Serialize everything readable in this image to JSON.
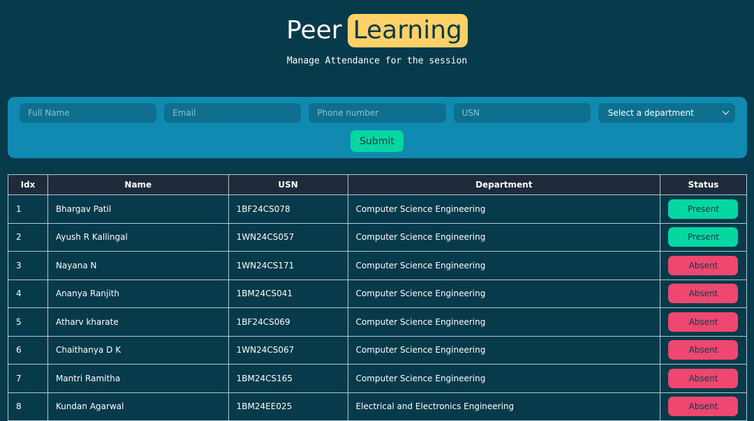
{
  "header": {
    "title_plain": "Peer",
    "title_highlight": "Learning",
    "subtitle": "Manage Attendance for the session"
  },
  "form": {
    "full_name_placeholder": "Full Name",
    "email_placeholder": "Email",
    "phone_placeholder": "Phone number",
    "usn_placeholder": "USN",
    "department_selected": "Select a department",
    "submit_label": "Submit"
  },
  "table": {
    "columns": [
      "Idx",
      "Name",
      "USN",
      "Department",
      "Status"
    ],
    "rows": [
      {
        "idx": "1",
        "name": "Bhargav Patil",
        "usn": "1BF24CS078",
        "department": "Computer Science Engineering",
        "status": "Present"
      },
      {
        "idx": "2",
        "name": "Ayush R Kallingal",
        "usn": "1WN24CS057",
        "department": "Computer Science Engineering",
        "status": "Present"
      },
      {
        "idx": "3",
        "name": "Nayana N",
        "usn": "1WN24CS171",
        "department": "Computer Science Engineering",
        "status": "Absent"
      },
      {
        "idx": "4",
        "name": "Ananya Ranjith",
        "usn": "1BM24CS041",
        "department": "Computer Science Engineering",
        "status": "Absent"
      },
      {
        "idx": "5",
        "name": "Atharv kharate",
        "usn": "1BF24CS069",
        "department": "Computer Science Engineering",
        "status": "Absent"
      },
      {
        "idx": "6",
        "name": "Chaithanya D K",
        "usn": "1WN24CS067",
        "department": "Computer Science Engineering",
        "status": "Absent"
      },
      {
        "idx": "7",
        "name": "Mantri Ramitha",
        "usn": "1BM24CS165",
        "department": "Computer Science Engineering",
        "status": "Absent"
      },
      {
        "idx": "8",
        "name": "Kundan Agarwal",
        "usn": "1BM24EE025",
        "department": "Electrical and Electronics Engineering",
        "status": "Absent"
      }
    ]
  },
  "colors": {
    "background": "#073b4c",
    "form_card": "#118ab2",
    "highlight": "#ffd166",
    "present": "#06d6a0",
    "absent": "#ef476f",
    "table_header": "#1f2a3a"
  }
}
